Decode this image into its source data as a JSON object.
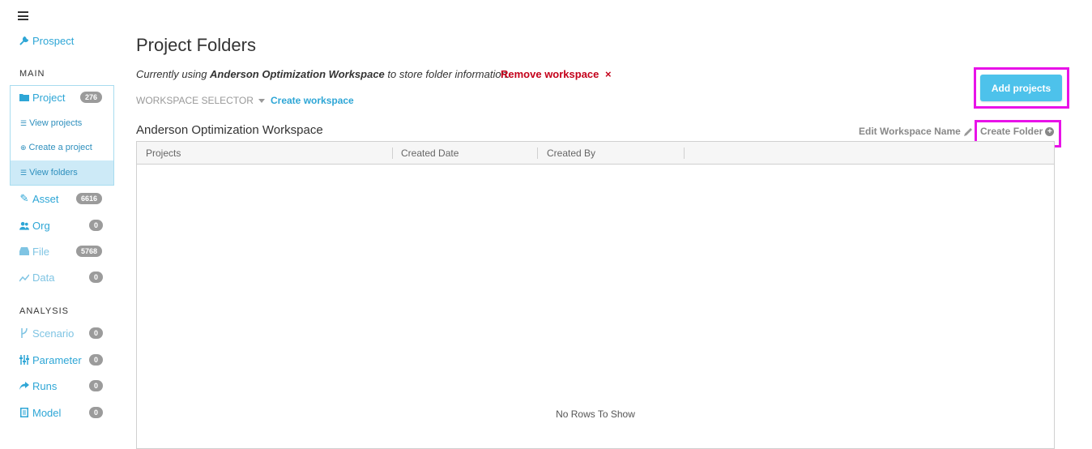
{
  "sidebar": {
    "prospect_label": "Prospect",
    "main_section": "MAIN",
    "analysis_section": "ANALYSIS",
    "project": {
      "label": "Project",
      "count": "276"
    },
    "sub_items": {
      "view_projects": "View projects",
      "create_project": "Create a project",
      "view_folders": "View folders"
    },
    "asset": {
      "label": "Asset",
      "count": "6616"
    },
    "org": {
      "label": "Org",
      "count": "0"
    },
    "file": {
      "label": "File",
      "count": "5768"
    },
    "data": {
      "label": "Data",
      "count": "0"
    },
    "scenario": {
      "label": "Scenario",
      "count": "0"
    },
    "parameter": {
      "label": "Parameter",
      "count": "0"
    },
    "runs": {
      "label": "Runs",
      "count": "0"
    },
    "model": {
      "label": "Model",
      "count": "0"
    }
  },
  "main": {
    "title": "Project Folders",
    "info_prefix": "Currently using ",
    "info_workspace": "Anderson Optimization Workspace",
    "info_suffix": " to store folder information.",
    "remove_workspace": "Remove workspace",
    "remove_icon": "×",
    "workspace_selector": "WORKSPACE SELECTOR",
    "create_workspace": "Create workspace",
    "add_projects": "Add projects",
    "workspace_name": "Anderson Optimization Workspace",
    "edit_workspace_name": "Edit Workspace Name",
    "create_folder": "Create Folder"
  },
  "grid": {
    "columns": [
      "Projects",
      "Created Date",
      "Created By"
    ],
    "empty_message": "No Rows To Show"
  },
  "colors": {
    "accent": "#2ea6d6",
    "button": "#4dc2eb",
    "danger": "#c4001a",
    "highlight": "#e812e8"
  }
}
